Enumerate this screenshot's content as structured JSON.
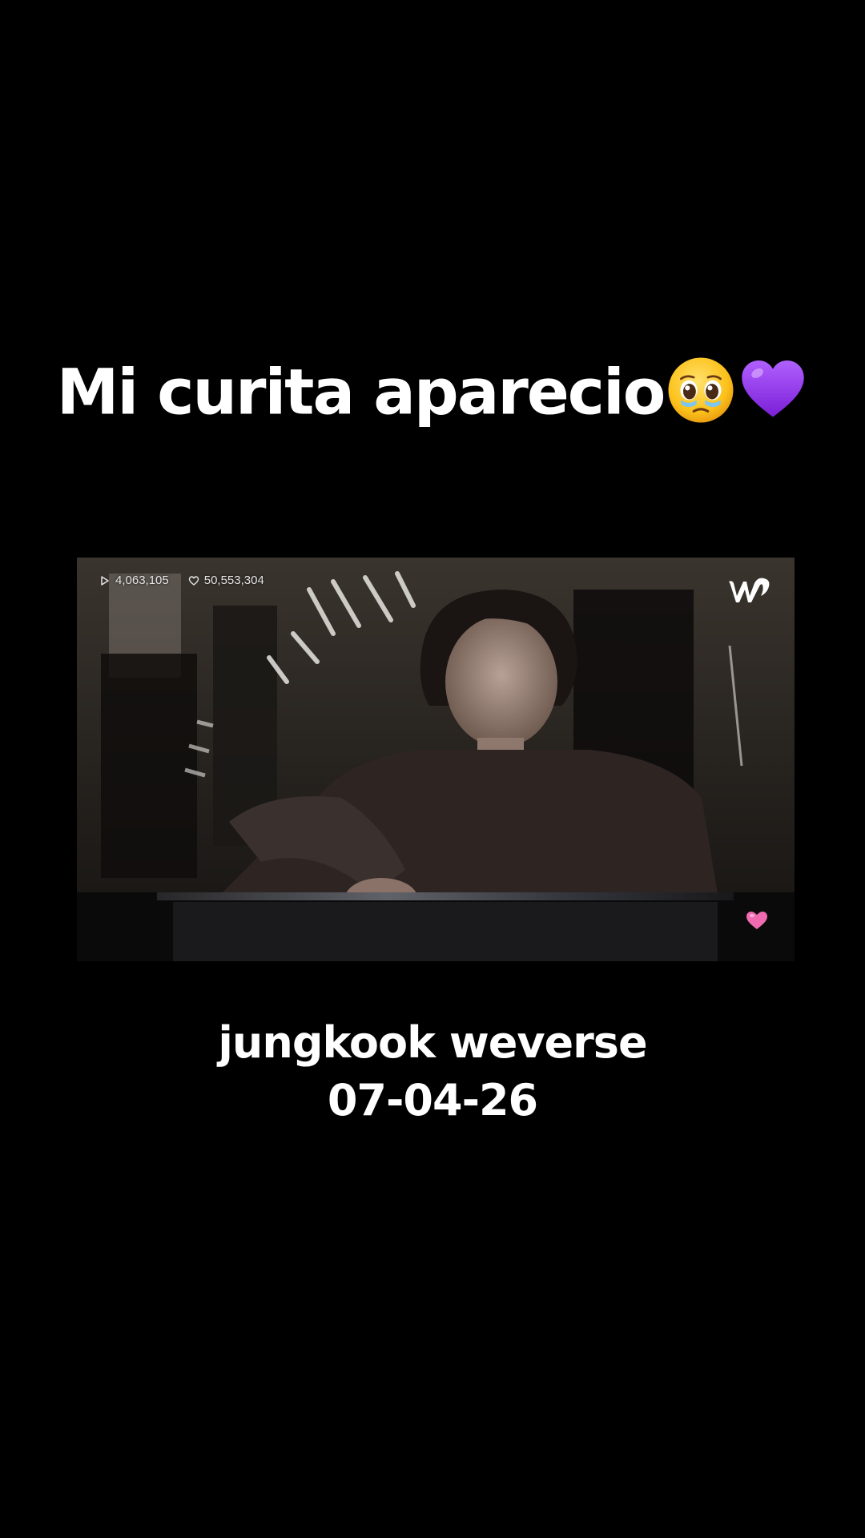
{
  "caption": {
    "title": "Mi curita aparecio",
    "emojis": [
      "pleading-face-emoji",
      "purple-heart-emoji"
    ],
    "line1": "jungkook weverse",
    "line2": "07-04-26"
  },
  "video": {
    "views": "4,063,105",
    "likes": "50,553,304",
    "logo": "weverse-logo",
    "overlay_icon": "pink-heart-icon"
  },
  "colors": {
    "background": "#000000",
    "text": "#ffffff",
    "accent_purple": "#9b3cf0",
    "heart_pink": "#f06ab0"
  }
}
